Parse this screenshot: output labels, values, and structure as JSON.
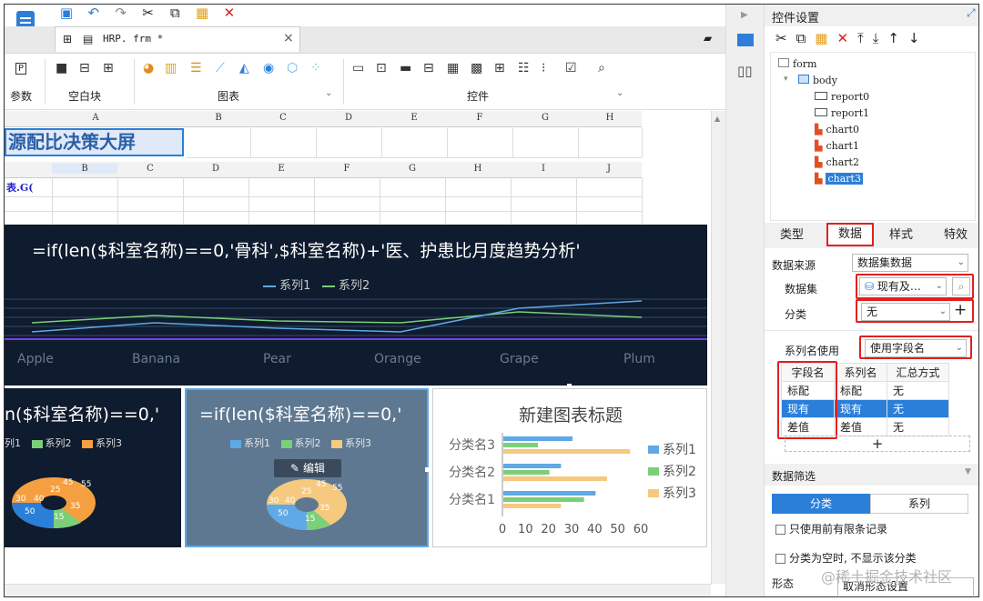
{
  "toolbar": {
    "tab_title": "HRP. frm *",
    "tab_close": "×",
    "groups": [
      {
        "label": "参数"
      },
      {
        "label": "空白块"
      },
      {
        "label": "图表"
      },
      {
        "label": "控件"
      }
    ]
  },
  "sheet": {
    "columns_top": [
      "A",
      "B",
      "C",
      "D",
      "E",
      "F",
      "G",
      "H"
    ],
    "columns_inner": [
      "B",
      "C",
      "D",
      "E",
      "F",
      "G",
      "H",
      "I",
      "J"
    ],
    "title_cell": "源配比决策大屏",
    "formula_cell": "表.G("
  },
  "chart_main": {
    "title": "=if(len($科室名称)==0,'骨科',$科室名称)+'医、护患比月度趋势分析'",
    "legend": [
      "系列1",
      "系列2"
    ],
    "categories": [
      "Apple",
      "Banana",
      "Pear",
      "Orange",
      "Grape",
      "Plum"
    ]
  },
  "chart_left": {
    "title": "n($科室名称)==0,'",
    "legend": [
      "列1",
      "系列2",
      "系列3"
    ],
    "labels": [
      "30",
      "40",
      "50",
      "25",
      "15",
      "35",
      "45",
      "55"
    ]
  },
  "chart_mid": {
    "title": "=if(len($科室名称)==0,'",
    "legend": [
      "系列1",
      "系列2",
      "系列3"
    ],
    "edit_label": "编辑",
    "labels": [
      "30",
      "40",
      "50",
      "25",
      "15",
      "35",
      "45",
      "55"
    ]
  },
  "chart_data": {
    "type": "bar",
    "orientation": "horizontal",
    "title": "新建图表标题",
    "categories": [
      "分类名1",
      "分类名2",
      "分类名3"
    ],
    "series": [
      {
        "name": "系列1",
        "values": [
          40,
          25,
          30
        ],
        "color": "#5ea9e6"
      },
      {
        "name": "系列2",
        "values": [
          35,
          20,
          15
        ],
        "color": "#79d079"
      },
      {
        "name": "系列3",
        "values": [
          25,
          45,
          55
        ],
        "color": "#f5c97f"
      }
    ],
    "xticks": [
      "0",
      "10",
      "20",
      "30",
      "40",
      "50",
      "60"
    ],
    "xlim": [
      0,
      60
    ],
    "legend_position": "right"
  },
  "right_panel": {
    "title": "控件设置",
    "tree": [
      "form",
      "body",
      "report0",
      "report1",
      "chart0",
      "chart1",
      "chart2",
      "chart3"
    ],
    "tabs": [
      "类型",
      "数据",
      "样式",
      "特效"
    ],
    "data_source_label": "数据来源",
    "data_source_value": "数据集数据",
    "dataset_label": "数据集",
    "dataset_value": "现有及…",
    "category_label": "分类",
    "category_value": "无",
    "series_name_label": "系列名使用",
    "series_name_value": "使用字段名",
    "table_headers": [
      "字段名",
      "系列名",
      "汇总方式"
    ],
    "table_rows": [
      [
        "标配",
        "标配",
        "无"
      ],
      [
        "现有",
        "现有",
        "无"
      ],
      [
        "差值",
        "差值",
        "无"
      ]
    ],
    "add_label": "+",
    "filter_title": "数据筛选",
    "filter_tabs": [
      "分类",
      "系列"
    ],
    "checkbox1": "只使用前有限条记录",
    "checkbox2": "分类为空时, 不显示该分类",
    "shape_label": "形态",
    "shape_value": "取消形态设置",
    "watermark": "@稀土掘金技术社区"
  },
  "colors": {
    "accent": "#2b7fd9",
    "highlight_red": "#e02020",
    "dark_bg": "#0f1b2e"
  }
}
